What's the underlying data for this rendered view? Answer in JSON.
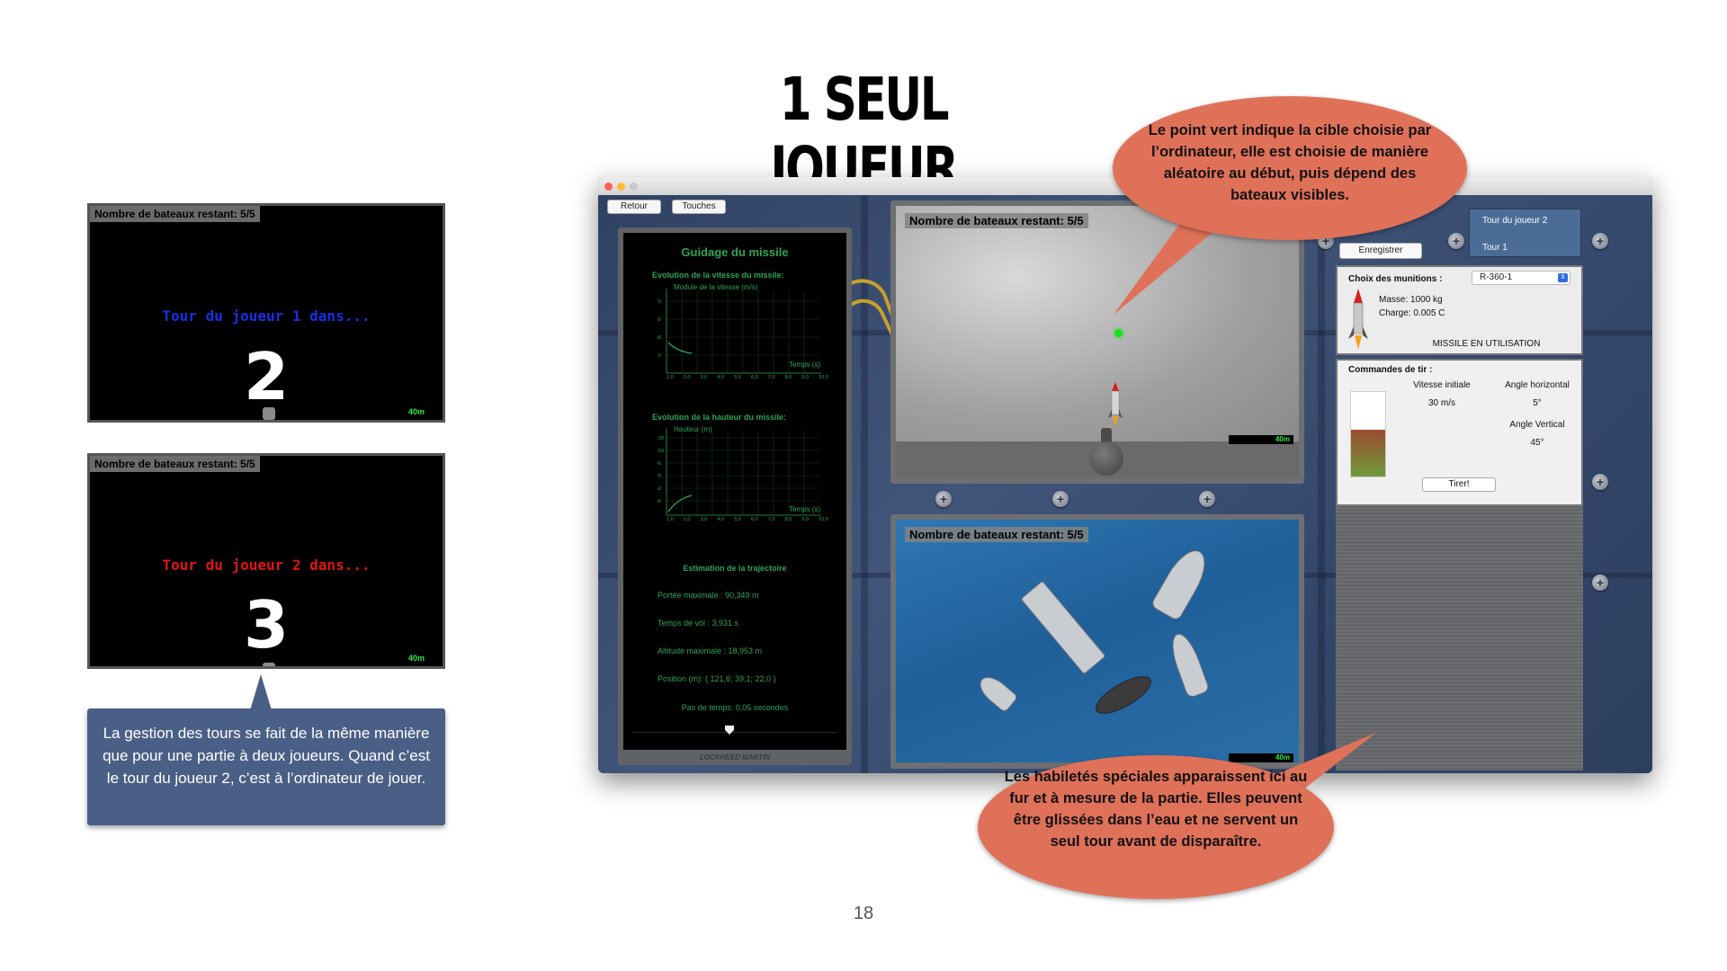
{
  "slide": {
    "title": "1 SEUL JOUEUR",
    "page_number": "18"
  },
  "left_screens": [
    {
      "ships_left": "Nombre de bateaux restant: 5/5",
      "turn_text": "Tour du joueur 1 dans...",
      "countdown": "2",
      "distance": "40m",
      "turn_color": "#1530e6"
    },
    {
      "ships_left": "Nombre de bateaux restant: 5/5",
      "turn_text": "Tour du joueur 2 dans...",
      "countdown": "3",
      "distance": "40m",
      "turn_color": "#e21414"
    }
  ],
  "left_callout": {
    "text": "La gestion des tours se fait de la même manière que pour une partie à deux joueurs. Quand c’est le tour du joueur 2, c’est à l’ordinateur de jouer."
  },
  "app": {
    "buttons": {
      "back": "Retour",
      "keys": "Touches",
      "save": "Enregistrer",
      "fire": "Tirer!"
    },
    "guidance": {
      "title": "Guidage du missile",
      "speed_section": "Evolution de la vitesse du missile:",
      "speed_axis": "Module de la vitesse (m/s)",
      "speed_time": "Temps (s)",
      "height_section": "Evolution de la hauteur du missile:",
      "height_axis": "Hauteur (m)",
      "height_time": "Temps (s)",
      "trajectory_title": "Estimation de la trajectoire",
      "max_range": "Portée maximale : 90,349 m",
      "flight_time": "Temps de vol : 3,931 s",
      "max_altitude": "Altitude maximale : 18,953 m",
      "position": "Position (m): ( 121,6; 39,1; 22,0 )",
      "time_step": "Pas de temps: 0,05 secondes",
      "footer": "LOCKHEED MARTIN",
      "x_ticks": [
        "1,0",
        "2,0",
        "3,0",
        "4,0",
        "5,0",
        "6,0",
        "7,0",
        "8,0",
        "9,0",
        "10,0"
      ]
    },
    "top_board": {
      "ships_left": "Nombre de bateaux restant: 5/5",
      "distance": "40m"
    },
    "bottom_board": {
      "ships_left": "Nombre de bateaux restant: 5/5",
      "distance": "40m"
    },
    "turn_box": {
      "line1": "Tour du joueur 2",
      "line2": "Tour 1"
    },
    "ammo": {
      "label": "Choix des munitions :",
      "selected": "R-360-1",
      "mass": "Masse: 1000 kg",
      "charge": "Charge: 0.005 C",
      "status": "MISSILE EN UTILISATION"
    },
    "fire_controls": {
      "title": "Commandes de tir :",
      "initial_speed_label": "Vitesse initiale",
      "initial_speed_value": "30 m/s",
      "h_angle_label": "Angle horizontal",
      "h_angle_value": "5°",
      "v_angle_label": "Angle Vertical",
      "v_angle_value": "45°",
      "power_level": 0.55
    }
  },
  "bubbles": {
    "top": "Le point vert indique la cible choisie par l’ordinateur, elle est choisie de manière aléatoire au début, puis dépend des bateaux visibles.",
    "bottom": "Les habiletés spéciales apparaissent ici au fur et à mesure de la partie. Elles peuvent être glissées dans l’eau et ne servent un seul tour avant de disparaître."
  },
  "colors": {
    "bubble": "#e07159",
    "callout": "#4a5f86",
    "guidance_green": "#2fa356",
    "target_green": "#18e018"
  }
}
